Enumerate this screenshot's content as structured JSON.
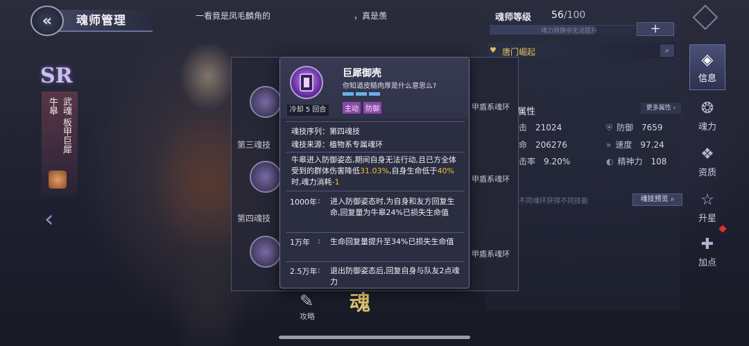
{
  "header": {
    "title": "魂师管理",
    "dialogue_left": "一看竟是凤毛麟角的",
    "dialogue_right": "，真是羡"
  },
  "hero": {
    "rank": "SR",
    "name": "牛皋",
    "title": "武魂 板甲巨犀"
  },
  "right_panel": {
    "level_label": "魂师等级",
    "level_current": "56",
    "level_max": "/100",
    "level_progress": 0.56,
    "level_hint": "魂力转换中无法提升",
    "plus_label": "+",
    "section_icon": "♥",
    "section_title": "唐门崛起",
    "attr_header": "属性",
    "more_attr_label": "更多属性",
    "stats": [
      {
        "label": "击",
        "value": "21024"
      },
      {
        "label": "防御",
        "value": "7659"
      },
      {
        "label": "命",
        "value": "206276"
      },
      {
        "label": "速度",
        "value": "97.24"
      },
      {
        "label": "击率",
        "value": "9.20%"
      },
      {
        "label": "精神力",
        "value": "108"
      }
    ],
    "armor_labels": [
      "甲盾系魂环",
      "甲盾系魂环",
      "甲盾系魂环"
    ],
    "ring_note": "不同魂环获得不同技能",
    "preview_label": "魂技预览"
  },
  "nav": [
    {
      "icon": "info-icon",
      "label": "信息",
      "active": true
    },
    {
      "icon": "soul-power-icon",
      "label": "魂力",
      "active": false
    },
    {
      "icon": "aptitude-icon",
      "label": "资质",
      "active": false
    },
    {
      "icon": "star-up-icon",
      "label": "升星",
      "active": false
    },
    {
      "icon": "add-point-icon",
      "label": "加点",
      "active": false
    }
  ],
  "skill_list": {
    "labels": [
      "第三魂技",
      "第四魂技"
    ],
    "bottom_label": "攻略",
    "bottom_soul": "魂"
  },
  "tooltip": {
    "cooldown": "冷却 5 回合",
    "name": "巨犀御壳",
    "desc": "你知道皮糙肉厚是什么意思么?",
    "tags": [
      "主动",
      "防御"
    ],
    "seq_line": "魂技序列：第四魂技",
    "src_line": "魂技来源：植物系专属魂环",
    "para_1": "牛皋进入防御姿态,期间自身无法行动,且已方全体受到的群体伤害降低",
    "para_hl1": "31.03%",
    "para_2": ",自身生命低于",
    "para_hl2": "40%",
    "para_3": "时,魂力消耗",
    "para_hl3": "-1",
    "years": [
      {
        "year": "1000年",
        "text": "进入防御姿态时,为自身和友方回复生命,回复量为牛皋24%已损失生命值"
      },
      {
        "year": "1万年",
        "text": "生命回复量提升至34%已损失生命值"
      },
      {
        "year": "2.5万年",
        "text": "退出防御姿态后,回复自身与队友2点魂力"
      }
    ]
  },
  "colors": {
    "highlight": "#f0c038",
    "tag_bg": "#8a4aa8",
    "pip": "#6ab0e8",
    "section_gold": "#e0c060"
  }
}
